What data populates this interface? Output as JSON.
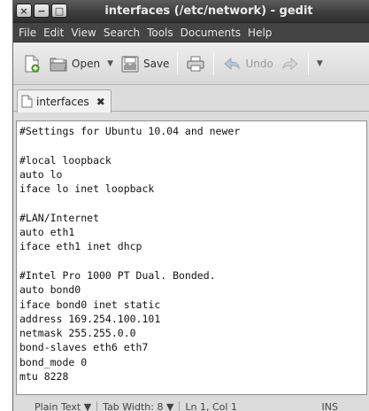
{
  "window": {
    "title": "interfaces (/etc/network) - gedit",
    "buttons": {
      "close": "×",
      "minimize": "−",
      "maximize": "□"
    }
  },
  "menubar": {
    "items": [
      "File",
      "Edit",
      "View",
      "Search",
      "Tools",
      "Documents",
      "Help"
    ]
  },
  "toolbar": {
    "open_label": "Open",
    "open_arrow": "▼",
    "save_label": "Save",
    "undo_label": "Undo",
    "more_arrow": "▼"
  },
  "tab": {
    "label": "interfaces",
    "close": "✖"
  },
  "editor": {
    "lines": [
      "#Settings for Ubuntu 10.04 and newer",
      "",
      "#local loopback",
      "auto lo",
      "iface lo inet loopback",
      "",
      "#LAN/Internet",
      "auto eth1",
      "iface eth1 inet dhcp",
      "",
      "#Intel Pro 1000 PT Dual. Bonded.",
      "auto bond0",
      "iface bond0 inet static",
      "address 169.254.100.101",
      "netmask 255.255.0.0",
      "bond-slaves eth6 eth7",
      "bond_mode 0",
      "mtu 8228",
      ""
    ]
  },
  "statusbar": {
    "language": "Plain Text ▼",
    "tab_width": "Tab Width: 8 ▼",
    "position": "Ln 1, Col 1",
    "mode": "INS"
  },
  "colors": {
    "titlebar": "#3e3e3e",
    "menubar": "#444444",
    "window_bg": "#dcdcdc"
  }
}
